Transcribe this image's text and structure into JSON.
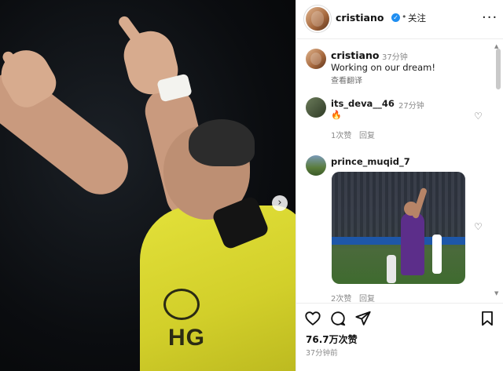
{
  "post": {
    "author": "cristiano",
    "follow_label": "关注",
    "separator": "•",
    "verified_mark": "✓",
    "more_label": "···",
    "carousel_next": "›",
    "jersey_text": "HG"
  },
  "caption": {
    "author": "cristiano",
    "time": "37分钟",
    "text": "Working on our dream!",
    "translate_label": "查看翻译"
  },
  "comments": [
    {
      "author": "its_deva__46",
      "time": "27分钟",
      "text": "🔥",
      "likes_label": "1次赞",
      "reply_label": "回复"
    },
    {
      "author": "prince_muqid_7",
      "time": "",
      "text": "",
      "likes_label": "2次赞",
      "reply_label": "回复"
    }
  ],
  "footer": {
    "likes": "76.7万次赞",
    "time_ago": "37分钟前"
  },
  "icons": {
    "heart": "♡"
  },
  "colors": {
    "verified": "#1f8ef1",
    "jersey": "#e3e13a"
  }
}
